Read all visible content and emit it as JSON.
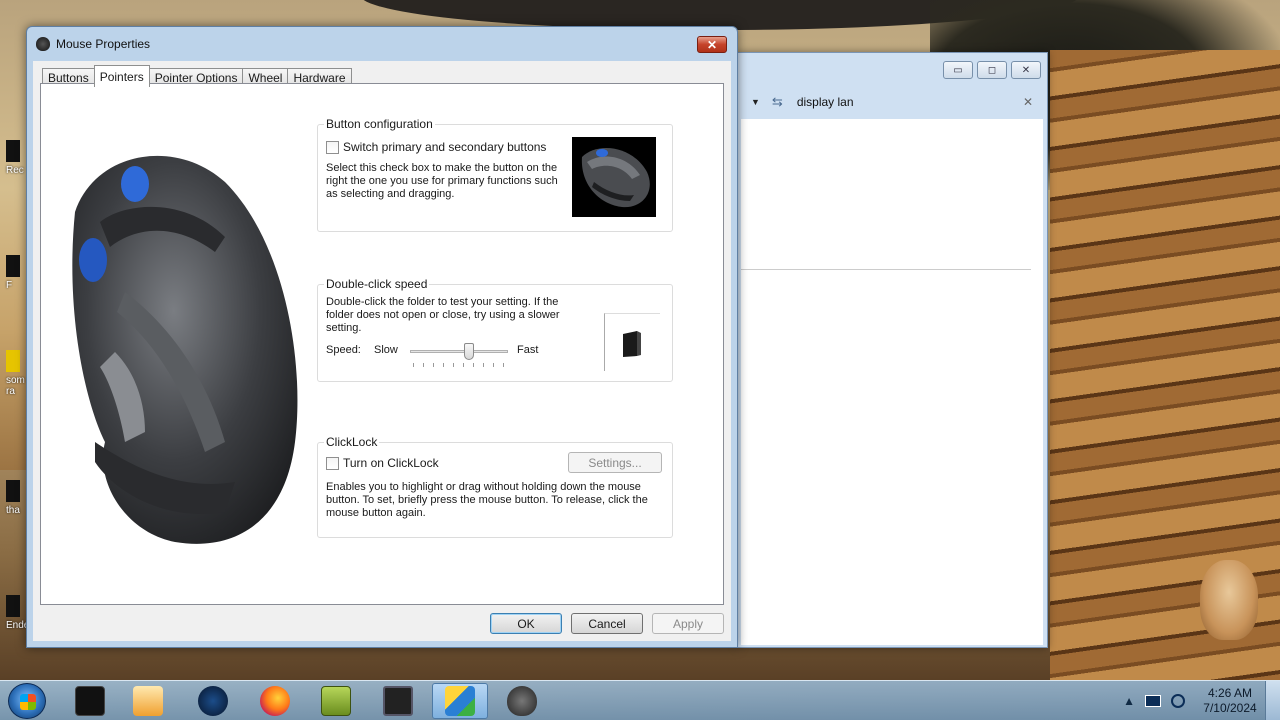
{
  "dialog": {
    "title": "Mouse Properties",
    "close_glyph": "✕",
    "tabs": [
      "Buttons",
      "Pointers",
      "Pointer Options",
      "Wheel",
      "Hardware"
    ],
    "active_tab": "Pointers"
  },
  "button_config": {
    "title": "Button configuration",
    "checkbox_label": "Switch primary and secondary buttons",
    "desc_lines": [
      "Select this check box to make the button on the",
      "right the one you use for primary functions such",
      "as selecting and dragging."
    ]
  },
  "double_click": {
    "title": "Double-click speed",
    "desc_lines": [
      "Double-click the folder to test your setting. If the",
      "folder does not open or close, try using a slower",
      "setting."
    ],
    "speed_label": "Speed:",
    "slow_label": "Slow",
    "fast_label": "Fast",
    "slider_fraction": 0.6
  },
  "clicklock": {
    "title": "ClickLock",
    "checkbox_label": "Turn on ClickLock",
    "settings_button": "Settings...",
    "desc_lines": [
      "Enables you to highlight or drag without holding down the mouse",
      "button. To set, briefly press the mouse button. To release, click the",
      "mouse button again."
    ]
  },
  "footer": {
    "ok": "OK",
    "cancel": "Cancel",
    "apply": "Apply"
  },
  "background_window": {
    "search_text": "display lan",
    "minimize_glyph": "▭",
    "maximize_glyph": "◻",
    "close_glyph": "✕",
    "search_close_glyph": "✕",
    "dropdown_glyph": "▼",
    "refresh_glyph": "⇆"
  },
  "desktop_icons": [
    "Rec",
    "F",
    "som",
    "ra",
    "tha",
    "Ende"
  ],
  "taskbar": {
    "items": [
      "start-orb-icon",
      "black-box-icon",
      "media-player-icon",
      "globe-icon",
      "firefox-icon",
      "box-game-icon",
      "monitor-icon",
      "control-panel-icon",
      "mouse-icon"
    ],
    "tray_arrow": "▲",
    "time": "4:26 AM",
    "date": "7/10/2024"
  }
}
